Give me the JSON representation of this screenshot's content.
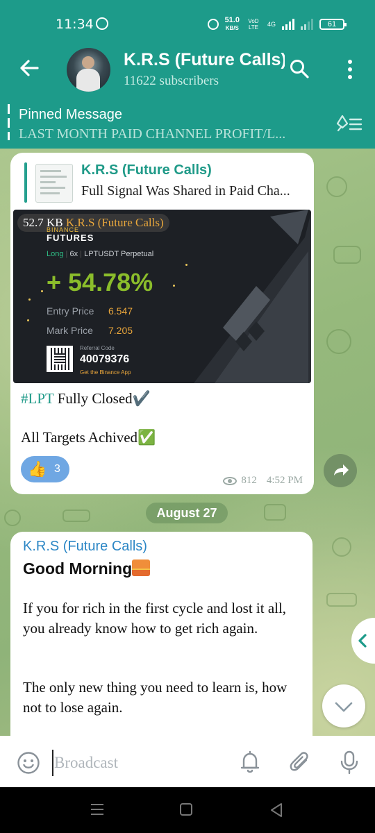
{
  "status": {
    "time": "11:34",
    "net_speed_value": "51.0",
    "net_speed_unit": "KB/S",
    "volte": "VoD LTE",
    "network": "4G",
    "battery": "61"
  },
  "header": {
    "title": "K.R.S (Future Calls)",
    "subtitle": "11622 subscribers"
  },
  "pinned": {
    "label": "Pinned Message",
    "text": "LAST MONTH PAID CHANNEL PROFIT/L..."
  },
  "post1": {
    "reply_name": "K.R.S (Future Calls)",
    "reply_text": "Full Signal Was Shared in Paid Cha...",
    "media": {
      "size": "52.7 KB",
      "source": "K.R.S (Future Calls)",
      "brand_top": "BINANCE",
      "brand": "FUTURES",
      "side": "Long",
      "leverage": "6x",
      "pair": "LPTUSDT Perpetual",
      "pnl": "+ 54.78%",
      "entry_label": "Entry Price",
      "entry_value": "6.547",
      "mark_label": "Mark Price",
      "mark_value": "7.205",
      "ref_label": "Referral Code",
      "ref_code": "40079376",
      "app_text": "Get the Binance App"
    },
    "line1_tag": "#LPT",
    "line1_rest": " Fully Closed✔️",
    "line2": "All Targets Achived✅",
    "reaction_emoji": "👍",
    "reaction_count": "3",
    "views": "812",
    "time": "4:52 PM"
  },
  "date_chip": "August 27",
  "post2": {
    "name": "K.R.S (Future Calls)",
    "greeting": "Good Morning",
    "para1": "If you for rich in the first cycle and lost it all, you already know how to get rich again.",
    "para2": "The only new thing you need to learn is, how not to lose again."
  },
  "input": {
    "placeholder": "Broadcast"
  },
  "colors": {
    "header": "#1d9b8a",
    "accent_name": "#1f9a88",
    "author_blue": "#2b86c5",
    "reaction": "#6fa7e3"
  }
}
